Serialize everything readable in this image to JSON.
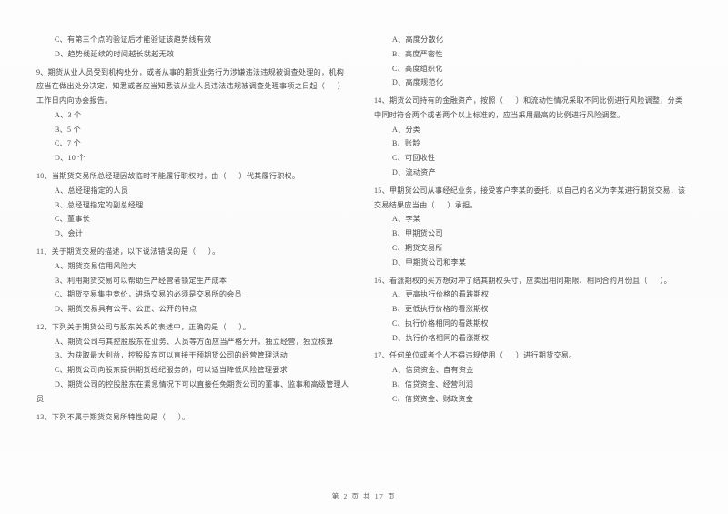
{
  "document": {
    "type": "exam-paper",
    "language": "zh-CN",
    "footer": "第 2 页  共 17 页",
    "page_number": 2,
    "total_pages": 17
  },
  "left_column": {
    "orphan_options": [
      "C、有第三个点的验证后才能验证该趋势线有效",
      "D、趋势线延续的时间越长就越无效"
    ],
    "questions": [
      {
        "number": "9",
        "stem_lines": [
          "9、期货从业人员受到机构处分，或者从事的期货业务行为涉嫌违法违规被调查处理的，机构",
          "应当在做出处分决定，知悉或者应当知悉该从业人员违法违规被调查处理事项之日起（      ）",
          "工作日内向协会报告。"
        ],
        "options": [
          "A、3 个",
          "B、5 个",
          "C、7 个",
          "D、10 个"
        ]
      },
      {
        "number": "10",
        "stem_lines": [
          "10、当期货交易所总经理因故临时不能履行职权时，由（      ）代其履行职权。"
        ],
        "options": [
          "A、总经理指定的人员",
          "B、总经理指定的副总经理",
          "C、董事长",
          "D、会计"
        ]
      },
      {
        "number": "11",
        "stem_lines": [
          "11、关于期货交易的描述，以下说法错误的是（      ）。"
        ],
        "options": [
          "A、期货交易信用风险大",
          "B、利用期货交易可以帮助生产经营者锁定生产成本",
          "C、期货交易集中竞价，进场交易的必须是交易所的会员",
          "D、期货交易具有公平、公正、公开的特点"
        ]
      },
      {
        "number": "12",
        "stem_lines": [
          "12、下列关于期货公司与股东关系的表述中，正确的是（      ）。"
        ],
        "options": [
          "A、期货公司与其控股股东在业务、人员等方面应当严格分开，独立经营，独立核算",
          "B、为获取最大利益，控股股东可以直接干预期货公司的经营管理活动",
          "C、期货公司向股东提供期货经纪服务的，可以适当降低风险管理要求",
          "D、期货公司的控股股东在紧急情况下可以直接任免期货公司的董事、监事和高级管理人"
        ],
        "option_wrap_tail": "员"
      },
      {
        "number": "13",
        "stem_lines": [
          "13、下列不属于期货交易所特性的是（      ）。"
        ],
        "options": []
      }
    ]
  },
  "right_column": {
    "orphan_options": [
      "A、高度分散化",
      "B、高度严密性",
      "C、高度组织化",
      "D、高度规范化"
    ],
    "questions": [
      {
        "number": "14",
        "stem_lines": [
          "14、期货公司持有的金融资产，按照（      ）和流动性情况采取不同比例进行风险调整，分类",
          "中同时符合两个或者两个以上标准的，应当采用最高的比例进行风险调整。"
        ],
        "options": [
          "A、分类",
          "B、账龄",
          "C、可回收性",
          "D、流动资产"
        ]
      },
      {
        "number": "15",
        "stem_lines": [
          "15、甲期货公司从事经纪业务，接受客户李某的委托，以自己的名义为李某进行期货交易，该",
          "交易结果应当由（      ）承担。"
        ],
        "options": [
          "A、李某",
          "B、甲期货公司",
          "C、期货交易所",
          "D、甲期货公司和李某"
        ]
      },
      {
        "number": "16",
        "stem_lines": [
          "16、看涨期权的买方想对冲了结其期权头寸，应卖出相同期限、相同合约月份且（      ）。"
        ],
        "options": [
          "A、更高执行价格的看跌期权",
          "B、更低执行价格的看涨期权",
          "C、执行价格相同的看跌期权",
          "D、执行价格相同的看涨期权"
        ]
      },
      {
        "number": "17",
        "stem_lines": [
          "17、任何单位或者个人不得违规使用（      ）进行期货交易。"
        ],
        "options": [
          "A、信贷资金、自有资金",
          "B、信贷资金、经营利润",
          "C、信贷资金、财政资金"
        ]
      }
    ]
  },
  "colors": {
    "page_background": "#ffffff",
    "text": "#4a4a4a",
    "footer_text": "#5a5a5a"
  }
}
